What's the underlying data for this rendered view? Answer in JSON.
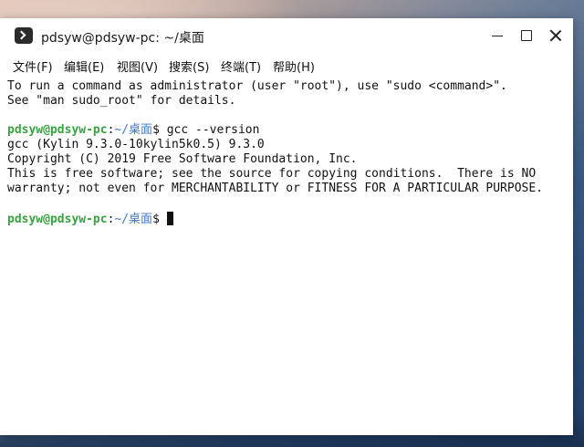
{
  "window": {
    "title": "pdsyw@pdsyw-pc: ~/桌面"
  },
  "menu": [
    "文件(F)",
    "编辑(E)",
    "视图(V)",
    "搜索(S)",
    "终端(T)",
    "帮助(H)"
  ],
  "terminal": {
    "lines": [
      "To run a command as administrator (user \"root\"), use \"sudo <command>\".",
      "See \"man sudo_root\" for details."
    ],
    "prompt1": {
      "user_host": "pdsyw@pdsyw-pc",
      "sep": ":",
      "path": "~/桌面",
      "symbol": "$",
      "command": " gcc --version"
    },
    "output": [
      "gcc (Kylin 9.3.0-10kylin5k0.5) 9.3.0",
      "Copyright (C) 2019 Free Software Foundation, Inc.",
      "This is free software; see the source for copying conditions.  There is NO",
      "warranty; not even for MERCHANTABILITY or FITNESS FOR A PARTICULAR PURPOSE."
    ],
    "prompt2": {
      "user_host": "pdsyw@pdsyw-pc",
      "sep": ":",
      "path": "~/桌面",
      "symbol": "$"
    }
  },
  "colors": {
    "prompt_user": "#3aa142",
    "prompt_path": "#3e78c9",
    "terminal_bg": "#ffffff",
    "terminal_fg": "#111111"
  },
  "icons": {
    "app": "terminal-icon",
    "minimize": "minimize-icon",
    "maximize": "maximize-icon",
    "close": "close-icon"
  }
}
